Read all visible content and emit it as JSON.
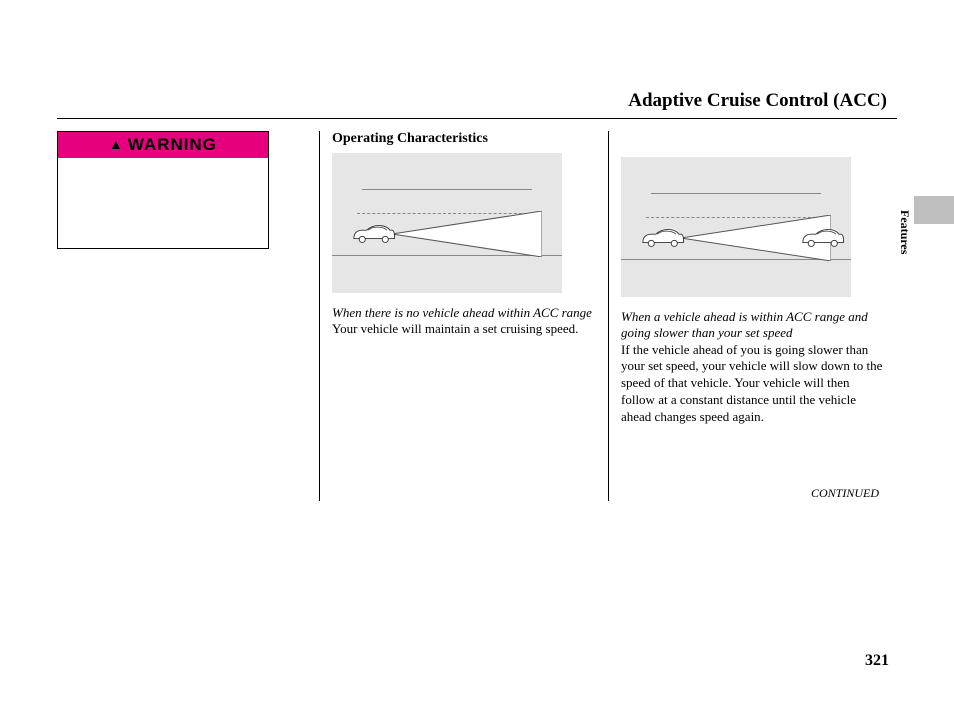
{
  "page": {
    "title": "Adaptive Cruise Control (ACC)",
    "number": "321",
    "continued": "CONTINUED",
    "side_label": "Features"
  },
  "warning": {
    "label": "WARNING"
  },
  "section": {
    "heading": "Operating Characteristics"
  },
  "col2": {
    "caption": "When there is no vehicle ahead within ACC range",
    "body": "Your vehicle will maintain a set cruising speed."
  },
  "col3": {
    "caption": "When a vehicle ahead is within ACC range and going slower than your set speed",
    "body": "If the vehicle ahead of you is going slower than your set speed, your vehicle will slow down to the speed of that vehicle. Your vehicle will then follow at a constant distance until the vehicle ahead changes speed again."
  }
}
